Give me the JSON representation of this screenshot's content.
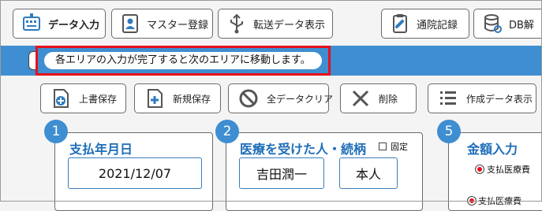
{
  "toolbar": {
    "buttons": [
      {
        "label": "データ入力",
        "icon": "keyboard-icon"
      },
      {
        "label": "マスター登録",
        "icon": "user-registration-icon"
      },
      {
        "label": "転送データ表示",
        "icon": "usb-icon"
      },
      {
        "label": "通院記録",
        "icon": "clipboard-icon"
      },
      {
        "label": "DB解",
        "icon": "database-icon"
      }
    ]
  },
  "message": {
    "text": "各エリアの入力が完了すると次のエリアに移動します。"
  },
  "actions": {
    "buttons": [
      {
        "label": "上書保存",
        "icon": "overwrite-save-icon"
      },
      {
        "label": "新規保存",
        "icon": "new-save-icon"
      },
      {
        "label": "全データクリア",
        "icon": "clear-prohibited-icon"
      },
      {
        "label": "削除",
        "icon": "delete-x-icon"
      },
      {
        "label": "作成データ表示",
        "icon": "list-icon"
      }
    ]
  },
  "panels": {
    "payment_date": {
      "number": "1",
      "title": "支払年月日",
      "value": "2021/12/07"
    },
    "patient": {
      "number": "2",
      "title": "医療を受けた人・続柄",
      "fixed_label": "固定",
      "name": "吉田潤一",
      "relation": "本人"
    },
    "amount": {
      "number": "5",
      "title": "金額入力",
      "option_paid": "支払医療費",
      "option_partial": "支払医療費"
    }
  },
  "colors": {
    "accent": "#3e8ed1",
    "highlight": "#e8101a",
    "title_blue": "#1e6db8"
  }
}
